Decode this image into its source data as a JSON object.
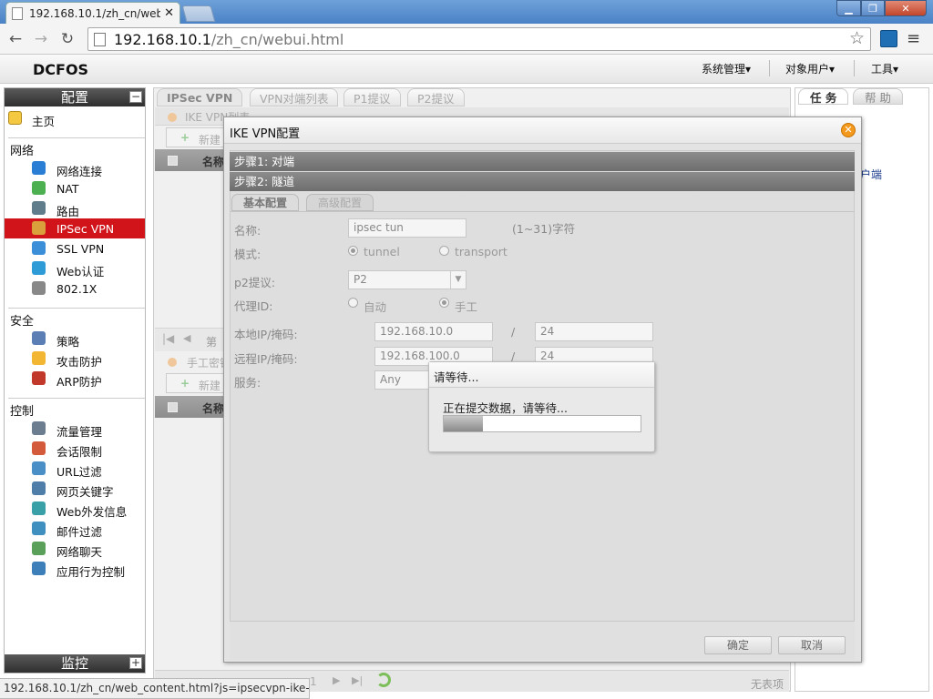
{
  "browser": {
    "tab_title": "192.168.10.1/zh_cn/web",
    "url_host": "192.168.10.1",
    "url_path": "/zh_cn/webui.html"
  },
  "app": {
    "logo": "DCFOS",
    "menus": [
      "系统管理▾",
      "对象用户▾",
      "工具▾"
    ]
  },
  "sidebar": {
    "config_header": "配置",
    "monitor_header": "监控",
    "home": "主页",
    "groups": [
      "网络",
      "安全",
      "控制"
    ],
    "network_items": [
      {
        "label": "网络连接",
        "icon": "globe-icon"
      },
      {
        "label": "NAT",
        "icon": "nat-globe-icon"
      },
      {
        "label": "路由",
        "icon": "router-icon"
      },
      {
        "label": "IPSec VPN",
        "icon": "ipsec-icon",
        "selected": true
      },
      {
        "label": "SSL VPN",
        "icon": "ssl-vpn-icon"
      },
      {
        "label": "Web认证",
        "icon": "web-auth-icon"
      },
      {
        "label": "802.1X",
        "icon": "dot1x-icon"
      }
    ],
    "security_items": [
      {
        "label": "策略",
        "icon": "policy-icon"
      },
      {
        "label": "攻击防护",
        "icon": "shield-icon"
      },
      {
        "label": "ARP防护",
        "icon": "arp-icon"
      }
    ],
    "control_items": [
      {
        "label": "流量管理",
        "icon": "traffic-icon"
      },
      {
        "label": "会话限制",
        "icon": "session-limit-icon"
      },
      {
        "label": "URL过滤",
        "icon": "url-filter-icon"
      },
      {
        "label": "网页关键字",
        "icon": "keyword-icon"
      },
      {
        "label": "Web外发信息",
        "icon": "web-outbound-icon"
      },
      {
        "label": "邮件过滤",
        "icon": "mail-filter-icon"
      },
      {
        "label": "网络聊天",
        "icon": "chat-icon"
      },
      {
        "label": "应用行为控制",
        "icon": "app-control-icon"
      }
    ]
  },
  "main": {
    "tabs": [
      "IPSec VPN",
      "VPN对端列表",
      "P1提议",
      "P2提议"
    ],
    "ike_section": "IKE VPN列表",
    "new_btn": "新建",
    "col_name": "名称",
    "pager_page": "第",
    "manual_section": "手工密钥",
    "pager_total": "1",
    "no_records": "无表项"
  },
  "right": {
    "tabs": [
      "任 务",
      "帮 助"
    ],
    "fragment": "户端"
  },
  "dialog": {
    "title": "IKE VPN配置",
    "step1": "步骤1: 对端",
    "step2": "步骤2: 隧道",
    "subtabs": [
      "基本配置",
      "高级配置"
    ],
    "name_label": "名称:",
    "name_value": "ipsec tun",
    "name_hint": "(1~31)字符",
    "mode_label": "模式:",
    "mode_tunnel": "tunnel",
    "mode_transport": "transport",
    "p2_label": "p2提议:",
    "p2_value": "P2",
    "proxy_label": "代理ID:",
    "proxy_auto": "自动",
    "proxy_manual": "手工",
    "local_label": "本地IP/掩码:",
    "local_ip": "192.168.10.0",
    "local_mask": "24",
    "remote_label": "远程IP/掩码:",
    "remote_ip": "192.168.100.0",
    "remote_mask": "24",
    "slash": "/",
    "service_label": "服务:",
    "service_value": "Any",
    "ok": "确定",
    "cancel": "取消"
  },
  "wait": {
    "title": "请等待...",
    "message": "正在提交数据，请等待...",
    "progress": 0.2
  },
  "status_url": "192.168.10.1/zh_cn/web_content.html?js=ipsecvpn-ike-c..."
}
